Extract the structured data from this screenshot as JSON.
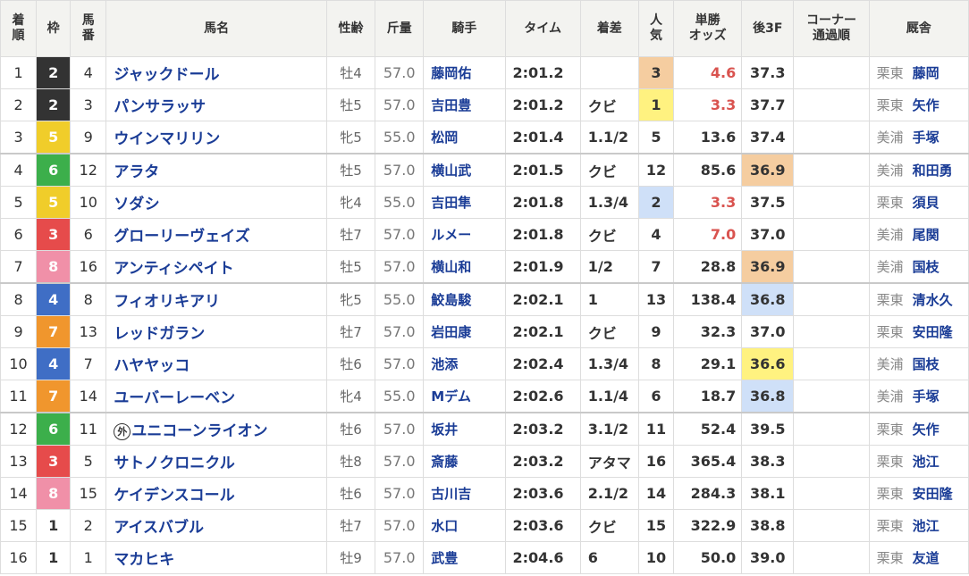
{
  "headers": {
    "rank": [
      "着",
      "順"
    ],
    "waku": "枠",
    "umaban": [
      "馬",
      "番"
    ],
    "horse": "馬名",
    "sexage": "性齢",
    "weight": "斤量",
    "jockey": "騎手",
    "time": "タイム",
    "margin": "着差",
    "pop": [
      "人",
      "気"
    ],
    "odds": [
      "単勝",
      "オッズ"
    ],
    "last3f": "後3F",
    "corner": [
      "コーナー",
      "通過順"
    ],
    "stable": "厩舎"
  },
  "colors": {
    "waku_1": "#ffffff",
    "waku_2": "#333333",
    "waku_3": "#e64b4b",
    "waku_4": "#3f6ec5",
    "waku_5": "#f0cd2a",
    "waku_6": "#3caf4b",
    "waku_7": "#f0962d",
    "waku_8": "#f090a8",
    "highlight_1st": "#f5cda0",
    "highlight_2nd": "#fff280",
    "highlight_3rd": "#cfe0f8",
    "link": "#1a3c96",
    "odds_red": "#d9534f"
  },
  "rows": [
    {
      "rank": "1",
      "waku": "2",
      "umaban": "4",
      "horse": "ジャックドール",
      "badge": "",
      "sexage": "牡4",
      "weight": "57.0",
      "jockey": "藤岡佑",
      "time": "2:01.2",
      "margin": "",
      "pop": "3",
      "odds": "4.6",
      "last3f": "37.3",
      "corner": "",
      "region": "栗東",
      "trainer": "藤岡"
    },
    {
      "rank": "2",
      "waku": "2",
      "umaban": "3",
      "horse": "パンサラッサ",
      "badge": "",
      "sexage": "牡5",
      "weight": "57.0",
      "jockey": "吉田豊",
      "time": "2:01.2",
      "margin": "クビ",
      "pop": "1",
      "odds": "3.3",
      "last3f": "37.7",
      "corner": "",
      "region": "栗東",
      "trainer": "矢作"
    },
    {
      "rank": "3",
      "waku": "5",
      "umaban": "9",
      "horse": "ウインマリリン",
      "badge": "",
      "sexage": "牝5",
      "weight": "55.0",
      "jockey": "松岡",
      "time": "2:01.4",
      "margin": "1.1/2",
      "pop": "5",
      "odds": "13.6",
      "last3f": "37.4",
      "corner": "",
      "region": "美浦",
      "trainer": "手塚"
    },
    {
      "rank": "4",
      "waku": "6",
      "umaban": "12",
      "horse": "アラタ",
      "badge": "",
      "sexage": "牡5",
      "weight": "57.0",
      "jockey": "横山武",
      "time": "2:01.5",
      "margin": "クビ",
      "pop": "12",
      "odds": "85.6",
      "last3f": "36.9",
      "corner": "",
      "region": "美浦",
      "trainer": "和田勇"
    },
    {
      "rank": "5",
      "waku": "5",
      "umaban": "10",
      "horse": "ソダシ",
      "badge": "",
      "sexage": "牝4",
      "weight": "55.0",
      "jockey": "吉田隼",
      "time": "2:01.8",
      "margin": "1.3/4",
      "pop": "2",
      "odds": "3.3",
      "last3f": "37.5",
      "corner": "",
      "region": "栗東",
      "trainer": "須貝"
    },
    {
      "rank": "6",
      "waku": "3",
      "umaban": "6",
      "horse": "グローリーヴェイズ",
      "badge": "",
      "sexage": "牡7",
      "weight": "57.0",
      "jockey": "ルメー",
      "time": "2:01.8",
      "margin": "クビ",
      "pop": "4",
      "odds": "7.0",
      "last3f": "37.0",
      "corner": "",
      "region": "美浦",
      "trainer": "尾関"
    },
    {
      "rank": "7",
      "waku": "8",
      "umaban": "16",
      "horse": "アンティシペイト",
      "badge": "",
      "sexage": "牡5",
      "weight": "57.0",
      "jockey": "横山和",
      "time": "2:01.9",
      "margin": "1/2",
      "pop": "7",
      "odds": "28.8",
      "last3f": "36.9",
      "corner": "",
      "region": "美浦",
      "trainer": "国枝"
    },
    {
      "rank": "8",
      "waku": "4",
      "umaban": "8",
      "horse": "フィオリキアリ",
      "badge": "",
      "sexage": "牝5",
      "weight": "55.0",
      "jockey": "鮫島駿",
      "time": "2:02.1",
      "margin": "1",
      "pop": "13",
      "odds": "138.4",
      "last3f": "36.8",
      "corner": "",
      "region": "栗東",
      "trainer": "清水久"
    },
    {
      "rank": "9",
      "waku": "7",
      "umaban": "13",
      "horse": "レッドガラン",
      "badge": "",
      "sexage": "牡7",
      "weight": "57.0",
      "jockey": "岩田康",
      "time": "2:02.1",
      "margin": "クビ",
      "pop": "9",
      "odds": "32.3",
      "last3f": "37.0",
      "corner": "",
      "region": "栗東",
      "trainer": "安田隆"
    },
    {
      "rank": "10",
      "waku": "4",
      "umaban": "7",
      "horse": "ハヤヤッコ",
      "badge": "",
      "sexage": "牡6",
      "weight": "57.0",
      "jockey": "池添",
      "time": "2:02.4",
      "margin": "1.3/4",
      "pop": "8",
      "odds": "29.1",
      "last3f": "36.6",
      "corner": "",
      "region": "美浦",
      "trainer": "国枝"
    },
    {
      "rank": "11",
      "waku": "7",
      "umaban": "14",
      "horse": "ユーバーレーベン",
      "badge": "",
      "sexage": "牝4",
      "weight": "55.0",
      "jockey": "Mデム",
      "time": "2:02.6",
      "margin": "1.1/4",
      "pop": "6",
      "odds": "18.7",
      "last3f": "36.8",
      "corner": "",
      "region": "美浦",
      "trainer": "手塚"
    },
    {
      "rank": "12",
      "waku": "6",
      "umaban": "11",
      "horse": "ユニコーンライオン",
      "badge": "外",
      "sexage": "牡6",
      "weight": "57.0",
      "jockey": "坂井",
      "time": "2:03.2",
      "margin": "3.1/2",
      "pop": "11",
      "odds": "52.4",
      "last3f": "39.5",
      "corner": "",
      "region": "栗東",
      "trainer": "矢作"
    },
    {
      "rank": "13",
      "waku": "3",
      "umaban": "5",
      "horse": "サトノクロニクル",
      "badge": "",
      "sexage": "牡8",
      "weight": "57.0",
      "jockey": "斎藤",
      "time": "2:03.2",
      "margin": "アタマ",
      "pop": "16",
      "odds": "365.4",
      "last3f": "38.3",
      "corner": "",
      "region": "栗東",
      "trainer": "池江"
    },
    {
      "rank": "14",
      "waku": "8",
      "umaban": "15",
      "horse": "ケイデンスコール",
      "badge": "",
      "sexage": "牡6",
      "weight": "57.0",
      "jockey": "古川吉",
      "time": "2:03.6",
      "margin": "2.1/2",
      "pop": "14",
      "odds": "284.3",
      "last3f": "38.1",
      "corner": "",
      "region": "栗東",
      "trainer": "安田隆"
    },
    {
      "rank": "15",
      "waku": "1",
      "umaban": "2",
      "horse": "アイスバブル",
      "badge": "",
      "sexage": "牡7",
      "weight": "57.0",
      "jockey": "水口",
      "time": "2:03.6",
      "margin": "クビ",
      "pop": "15",
      "odds": "322.9",
      "last3f": "38.8",
      "corner": "",
      "region": "栗東",
      "trainer": "池江"
    },
    {
      "rank": "16",
      "waku": "1",
      "umaban": "1",
      "horse": "マカヒキ",
      "badge": "",
      "sexage": "牡9",
      "weight": "57.0",
      "jockey": "武豊",
      "time": "2:04.6",
      "margin": "6",
      "pop": "10",
      "odds": "50.0",
      "last3f": "39.0",
      "corner": "",
      "region": "栗東",
      "trainer": "友道"
    }
  ]
}
